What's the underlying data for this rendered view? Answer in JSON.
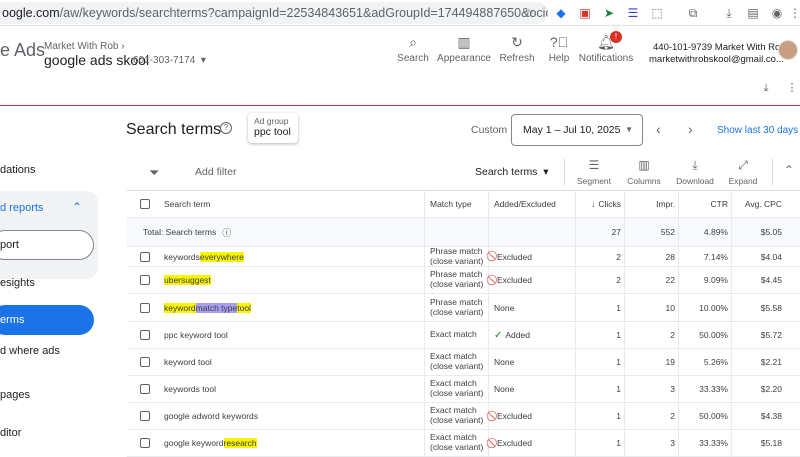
{
  "browser": {
    "url_host": "google.com",
    "url_path": "/aw/keywords/searchterms?campaignId=22534843651&adGroupId=174494887650&ocid=6771757438...",
    "url_prefix_visible": "oogle.com"
  },
  "header": {
    "brand_partial": "e Ads",
    "account_parent": "Market With Rob",
    "account_name": "google ads skool",
    "account_id": "601-303-7174",
    "tools": [
      {
        "label": "Search",
        "icon": "search-icon"
      },
      {
        "label": "Appearance",
        "icon": "appearance-icon"
      },
      {
        "label": "Refresh",
        "icon": "refresh-icon"
      },
      {
        "label": "Help",
        "icon": "help-icon"
      },
      {
        "label": "Notifications",
        "icon": "bell-icon"
      }
    ],
    "notification_count": "!",
    "user_line1": "440-101-9739 Market With Rob",
    "user_line2": "marketwithrobskool@gmail.co..."
  },
  "nav": {
    "items": [
      {
        "label": "dations"
      },
      {
        "label": "d reports"
      },
      {
        "label": "port"
      },
      {
        "label": "esights"
      },
      {
        "label": "erms"
      },
      {
        "label": "d where ads"
      },
      {
        "label": "pages"
      },
      {
        "label": "ditor"
      }
    ]
  },
  "page": {
    "title": "Search terms",
    "adgroup_label": "Ad group",
    "adgroup_value": "ppc tool",
    "custom_label": "Custom",
    "date_range": "May 1 – Jul 10, 2025",
    "show_last_30": "Show last 30 days"
  },
  "toolbar": {
    "add_filter": "Add filter",
    "type_select": "Search terms",
    "buttons": [
      {
        "label": "Segment",
        "icon": "segment-icon"
      },
      {
        "label": "Columns",
        "icon": "columns-icon"
      },
      {
        "label": "Download",
        "icon": "download-icon"
      },
      {
        "label": "Expand",
        "icon": "expand-icon"
      }
    ]
  },
  "table": {
    "columns": [
      "Search term",
      "Match type",
      "Added/Excluded",
      "Clicks",
      "Impr.",
      "CTR",
      "Avg. CPC"
    ],
    "total": {
      "label": "Total: Search terms",
      "clicks": "27",
      "impr": "552",
      "ctr": "4.89%",
      "cpc": "$5.05"
    },
    "rows": [
      {
        "term_pre": "keywords ",
        "term_hl": "everywhere",
        "term_hl2": "",
        "term_post": "",
        "match1": "Phrase match",
        "match2": "(close variant)",
        "status": "Excluded",
        "status_type": "excluded",
        "clicks": "2",
        "impr": "28",
        "ctr": "7.14%",
        "cpc": "$4.04"
      },
      {
        "term_pre": "",
        "term_hl": "ubersuggest",
        "term_hl2": "",
        "term_post": "",
        "match1": "Phrase match",
        "match2": "(close variant)",
        "status": "Excluded",
        "status_type": "excluded",
        "clicks": "2",
        "impr": "22",
        "ctr": "9.09%",
        "cpc": "$4.45"
      },
      {
        "term_pre": "",
        "term_hl": "keyword ",
        "term_hl2": "match type",
        "term_post": " tool",
        "match1": "Phrase match",
        "match2": "(close variant)",
        "status": "None",
        "status_type": "none",
        "clicks": "1",
        "impr": "10",
        "ctr": "10.00%",
        "cpc": "$5.58"
      },
      {
        "term_pre": "ppc keyword tool",
        "term_hl": "",
        "term_hl2": "",
        "term_post": "",
        "match1": "Exact match",
        "match2": "",
        "status": "Added",
        "status_type": "added",
        "clicks": "1",
        "impr": "2",
        "ctr": "50.00%",
        "cpc": "$5.72"
      },
      {
        "term_pre": "keyword tool",
        "term_hl": "",
        "term_hl2": "",
        "term_post": "",
        "match1": "Exact match",
        "match2": "(close variant)",
        "status": "None",
        "status_type": "none",
        "clicks": "1",
        "impr": "19",
        "ctr": "5.26%",
        "cpc": "$2.21"
      },
      {
        "term_pre": "keywords tool",
        "term_hl": "",
        "term_hl2": "",
        "term_post": "",
        "match1": "Exact match",
        "match2": "(close variant)",
        "status": "None",
        "status_type": "none",
        "clicks": "1",
        "impr": "3",
        "ctr": "33.33%",
        "cpc": "$2.20"
      },
      {
        "term_pre": "google adword keywords",
        "term_hl": "",
        "term_hl2": "",
        "term_post": "",
        "match1": "Exact match",
        "match2": "(close variant)",
        "status": "Excluded",
        "status_type": "excluded",
        "clicks": "1",
        "impr": "2",
        "ctr": "50.00%",
        "cpc": "$4.38"
      },
      {
        "term_pre": "google keyword ",
        "term_hl": "research",
        "term_hl2": "",
        "term_post": "",
        "match1": "Exact match",
        "match2": "(close variant)",
        "status": "Excluded",
        "status_type": "excluded",
        "clicks": "1",
        "impr": "3",
        "ctr": "33.33%",
        "cpc": "$5.18"
      }
    ]
  }
}
